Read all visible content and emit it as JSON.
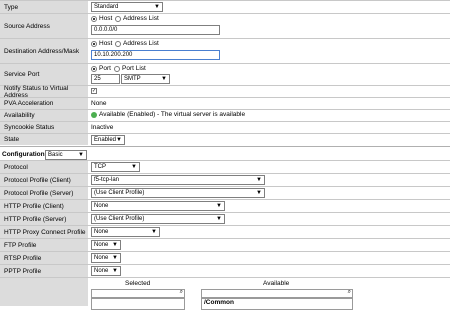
{
  "type": {
    "label": "Type",
    "value": "Standard"
  },
  "source": {
    "label": "Source Address",
    "opt_host": "Host",
    "opt_list": "Address List",
    "value": "0.0.0.0/0"
  },
  "dest": {
    "label": "Destination Address/Mask",
    "opt_host": "Host",
    "opt_list": "Address List",
    "value": "10.10.200.200"
  },
  "service": {
    "label": "Service Port",
    "opt_port": "Port",
    "opt_list": "Port List",
    "port": "25",
    "protocol": "SMTP"
  },
  "notify": {
    "label": "Notify Status to Virtual Address"
  },
  "pva": {
    "label": "PVA Acceleration",
    "value": "None"
  },
  "availability": {
    "label": "Availability",
    "value": "Available (Enabled) - The virtual server is available"
  },
  "syncookie": {
    "label": "Syncookie Status",
    "value": "Inactive"
  },
  "state": {
    "label": "State",
    "value": "Enabled"
  },
  "config": {
    "label": "Configuration:",
    "mode": "Basic"
  },
  "protocol": {
    "label": "Protocol",
    "value": "TCP"
  },
  "pp_client": {
    "label": "Protocol Profile (Client)",
    "value": "f5-tcp-lan"
  },
  "pp_server": {
    "label": "Protocol Profile (Server)",
    "value": "(Use Client Profile)"
  },
  "http_client": {
    "label": "HTTP Profile (Client)",
    "value": "None"
  },
  "http_server": {
    "label": "HTTP Profile (Server)",
    "value": "(Use Client Profile)"
  },
  "http_proxy": {
    "label": "HTTP Proxy Connect Profile",
    "value": "None"
  },
  "ftp": {
    "label": "FTP Profile",
    "value": "None"
  },
  "rtsp": {
    "label": "RTSP Profile",
    "value": "None"
  },
  "pptp": {
    "label": "PPTP Profile",
    "value": "None"
  },
  "lists": {
    "selected": "Selected",
    "available": "Available",
    "available_item": "/Common"
  }
}
